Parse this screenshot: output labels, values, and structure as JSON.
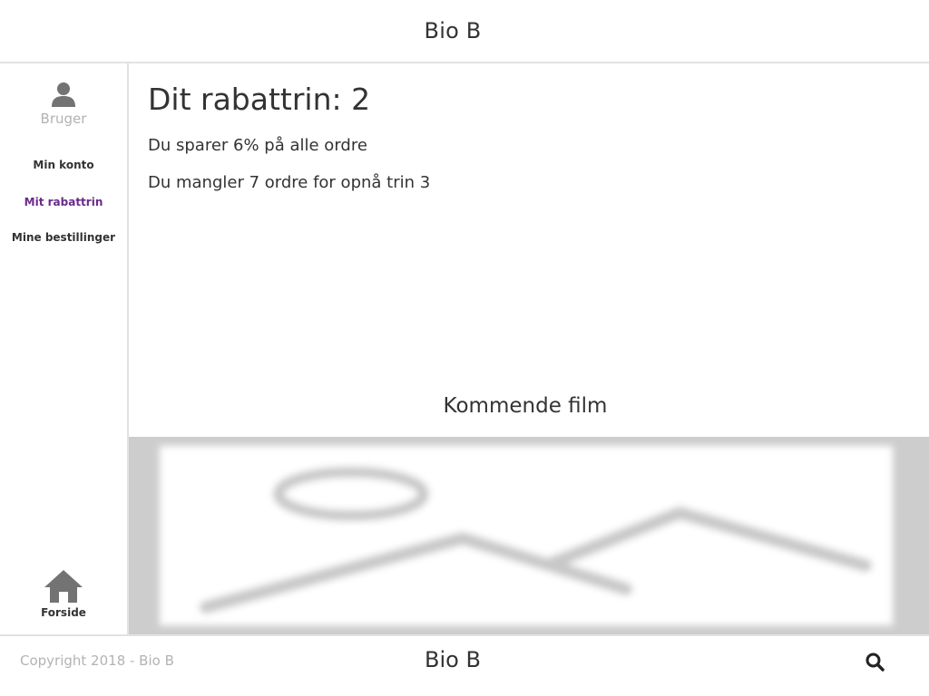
{
  "header": {
    "title": "Bio B"
  },
  "sidebar": {
    "user_icon": "user-icon",
    "user_label": "Bruger",
    "items": [
      {
        "label": "Min konto",
        "active": false
      },
      {
        "label": "Mit rabattrin",
        "active": true
      },
      {
        "label": "Mine bestillinger",
        "active": false
      }
    ],
    "home": {
      "icon": "home-icon",
      "label": "Forside"
    }
  },
  "main": {
    "heading": "Dit rabattrin: 2",
    "savings_text": "Du sparer 6% på alle ordre",
    "missing_text": "Du mangler 7 ordre for opnå trin 3",
    "upcoming_title": "Kommende film",
    "upcoming_image": "image-placeholder-icon"
  },
  "footer": {
    "copyright": "Copyright 2018 - Bio B",
    "title": "Bio B",
    "search_icon": "search-icon"
  },
  "colors": {
    "accent": "#6a2a8c",
    "muted_text": "#b3b3b3",
    "icon_gray": "#737373",
    "border": "#e2e2e2"
  }
}
